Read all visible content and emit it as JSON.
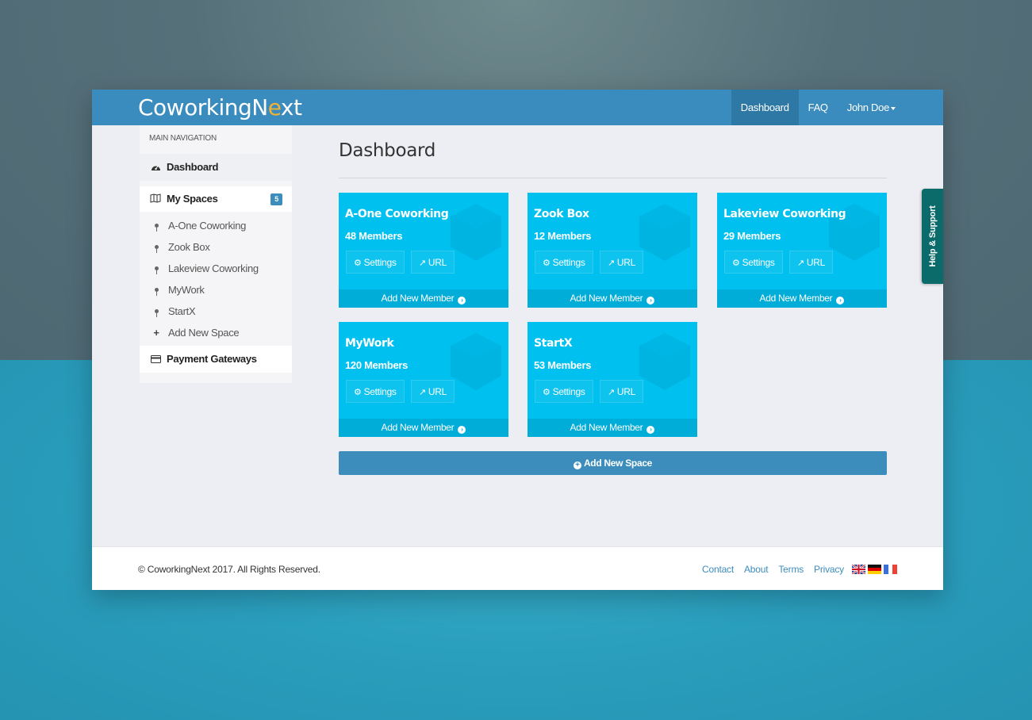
{
  "app": {
    "logo_prefix": "CoworkingN",
    "logo_accent": "e",
    "logo_suffix": "xt"
  },
  "topnav": {
    "dashboard": "Dashboard",
    "faq": "FAQ",
    "user": "John Doe"
  },
  "sidebar": {
    "header": "MAIN NAVIGATION",
    "dashboard": "Dashboard",
    "my_spaces": "My Spaces",
    "my_spaces_count": "5",
    "spaces": [
      "A-One Coworking",
      "Zook Box",
      "Lakeview Coworking",
      "MyWork",
      "StartX"
    ],
    "add_new_space": "Add New Space",
    "payment_gateways": "Payment Gateways"
  },
  "main": {
    "title": "Dashboard",
    "cards": [
      {
        "name": "A-One Coworking",
        "members": "48 Members"
      },
      {
        "name": "Zook Box",
        "members": "12 Members"
      },
      {
        "name": "Lakeview Coworking",
        "members": "29 Members"
      },
      {
        "name": "MyWork",
        "members": "120 Members"
      },
      {
        "name": "StartX",
        "members": "53 Members"
      }
    ],
    "settings_label": "Settings",
    "url_label": "URL",
    "add_member_label": "Add New Member",
    "add_space_label": "Add New Space"
  },
  "footer": {
    "copyright": "© CoworkingNext 2017. All Rights Reserved.",
    "links": [
      "Contact",
      "About",
      "Terms",
      "Privacy"
    ]
  },
  "help": {
    "label": "Help & Support"
  },
  "colors": {
    "topbar": "#398cbd",
    "card": "#00c0ef",
    "card_footer": "#00acd8",
    "primary": "#3c8dbc",
    "help_tab": "#0b6b6b",
    "logo_accent": "#f2b134"
  }
}
